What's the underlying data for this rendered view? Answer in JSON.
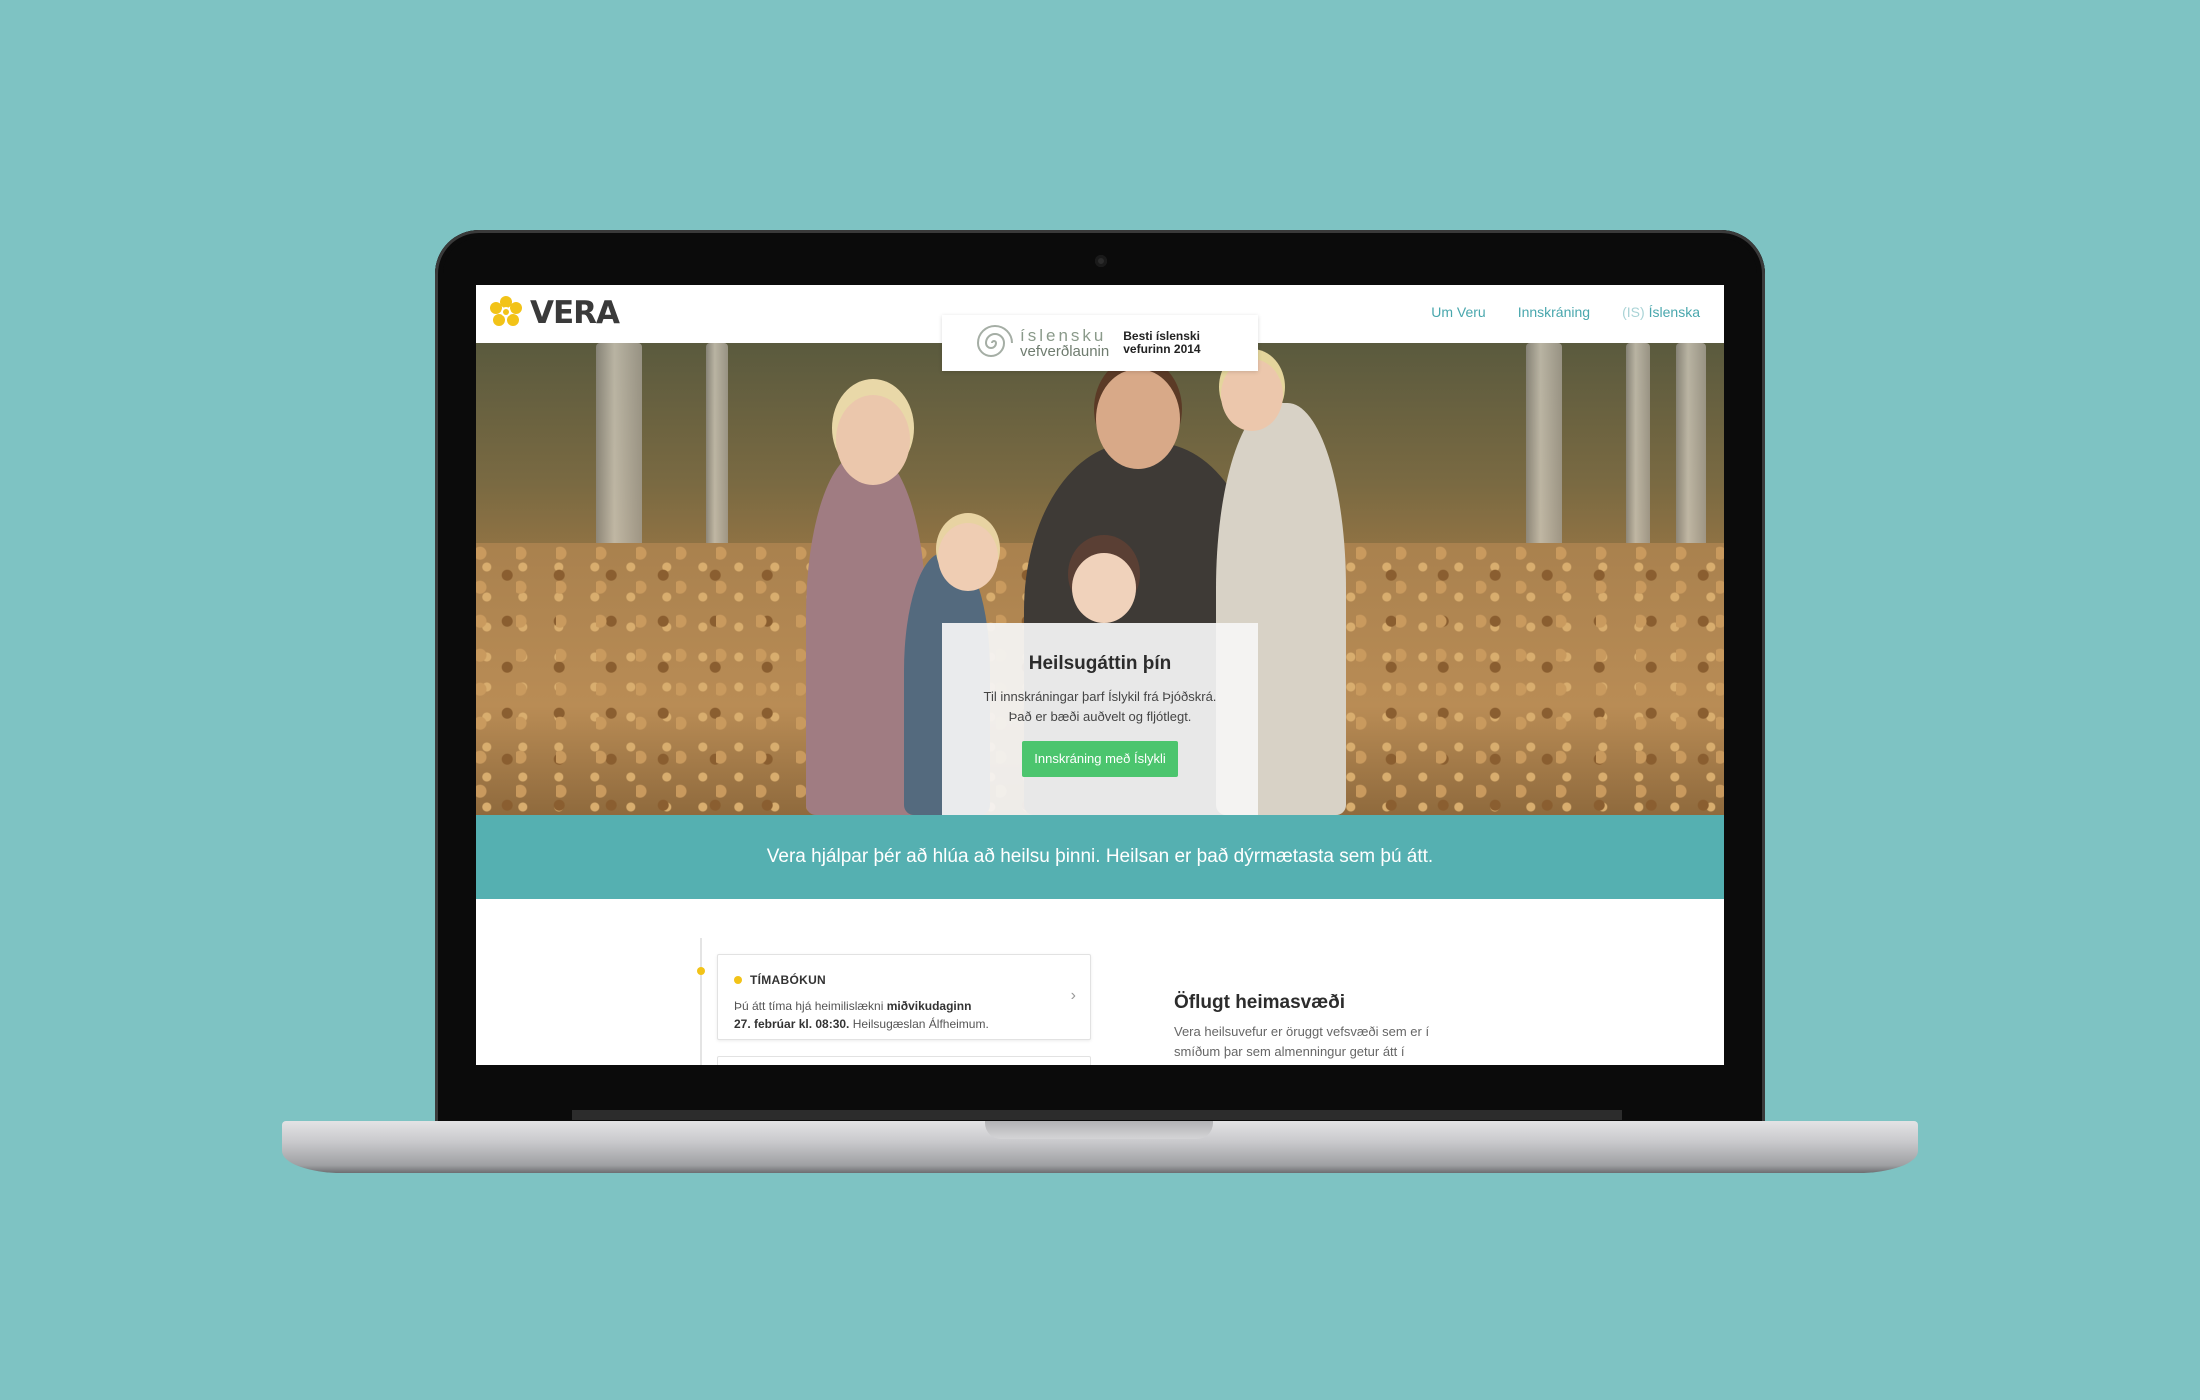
{
  "header": {
    "logo_text": "VERA",
    "nav": {
      "about": "Um Veru",
      "login": "Innskráning",
      "lang_code": "(IS)",
      "lang_label": "Íslenska"
    }
  },
  "award": {
    "name_line1": "íslensku",
    "name_line2": "vefverðlaunin",
    "subtitle_line1": "Besti íslenski",
    "subtitle_line2": "vefurinn 2014"
  },
  "hero": {
    "title": "Heilsugáttin þín",
    "text_line1": "Til innskráningar þarf Íslykil frá Þjóðskrá.",
    "text_line2": "Það er bæði auðvelt og fljótlegt.",
    "button_label": "Innskráning með Íslykli"
  },
  "band": {
    "text": "Vera hjálpar þér að hlúa að heilsu þinni. Heilsan er það dýrmætasta sem þú átt."
  },
  "booking": {
    "label": "TÍMABÓKUN",
    "text_prefix": "Þú átt tíma hjá heimilislækni ",
    "text_bold1": "miðvikudaginn",
    "text_bold2": "27. febrúar kl. 08:30.",
    "text_suffix": " Heilsugæslan Álfheimum."
  },
  "feature": {
    "title": "Öflugt heimasvæði",
    "text": "Vera heilsuvefur er öruggt vefsvæði sem er í smíðum þar sem almenningur getur átt í"
  },
  "colors": {
    "background": "#7ec3c3",
    "teal": "#55b0b1",
    "nav": "#49a7ad",
    "green_button": "#4cc56e",
    "yellow_accent": "#f2c318"
  }
}
